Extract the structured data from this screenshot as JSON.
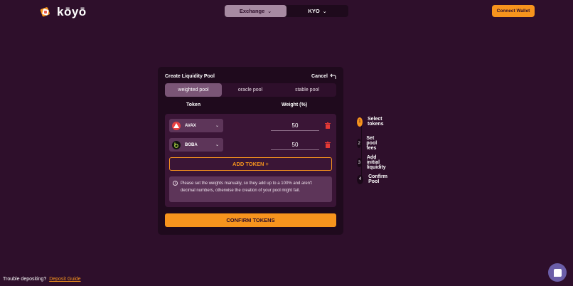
{
  "brand": {
    "name": "kōyō"
  },
  "nav": {
    "items": [
      {
        "label": "Exchange",
        "active": true
      },
      {
        "label": "KYO",
        "active": false
      }
    ]
  },
  "header": {
    "connect_label": "Connect Wallet"
  },
  "card": {
    "title": "Create Liquidity Pool",
    "cancel_label": "Cancel",
    "tabs": [
      {
        "label": "weighted pool",
        "active": true
      },
      {
        "label": "oracle pool",
        "active": false
      },
      {
        "label": "stable pool",
        "active": false
      }
    ],
    "col_token": "Token",
    "col_weight": "Weight (%)",
    "tokens": [
      {
        "symbol": "AVAX",
        "weight": "50",
        "icon": "avax-icon"
      },
      {
        "symbol": "BOBA",
        "weight": "50",
        "icon": "boba-icon"
      }
    ],
    "add_token_label": "ADD TOKEN +",
    "notice": "Please set the weights manually, so they add up to a 100% and aren't decimal numbers, otherwise the creation of your pool might fail.",
    "confirm_label": "CONFIRM TOKENS"
  },
  "steps": [
    {
      "num": "1",
      "label": "Select tokens",
      "active": true
    },
    {
      "num": "2",
      "label": "Set pool fees",
      "active": false
    },
    {
      "num": "3",
      "label": "Add initial liquidity",
      "active": false
    },
    {
      "num": "4",
      "label": "Confirm Pool",
      "active": false
    }
  ],
  "footer": {
    "text": "Trouble depositing?",
    "link": "Deposit Guide"
  },
  "colors": {
    "background": "#2e0f2b",
    "accent": "#f7941d",
    "card": "#1f0a1d",
    "active_tab": "#7a5576",
    "danger": "#e53935"
  }
}
